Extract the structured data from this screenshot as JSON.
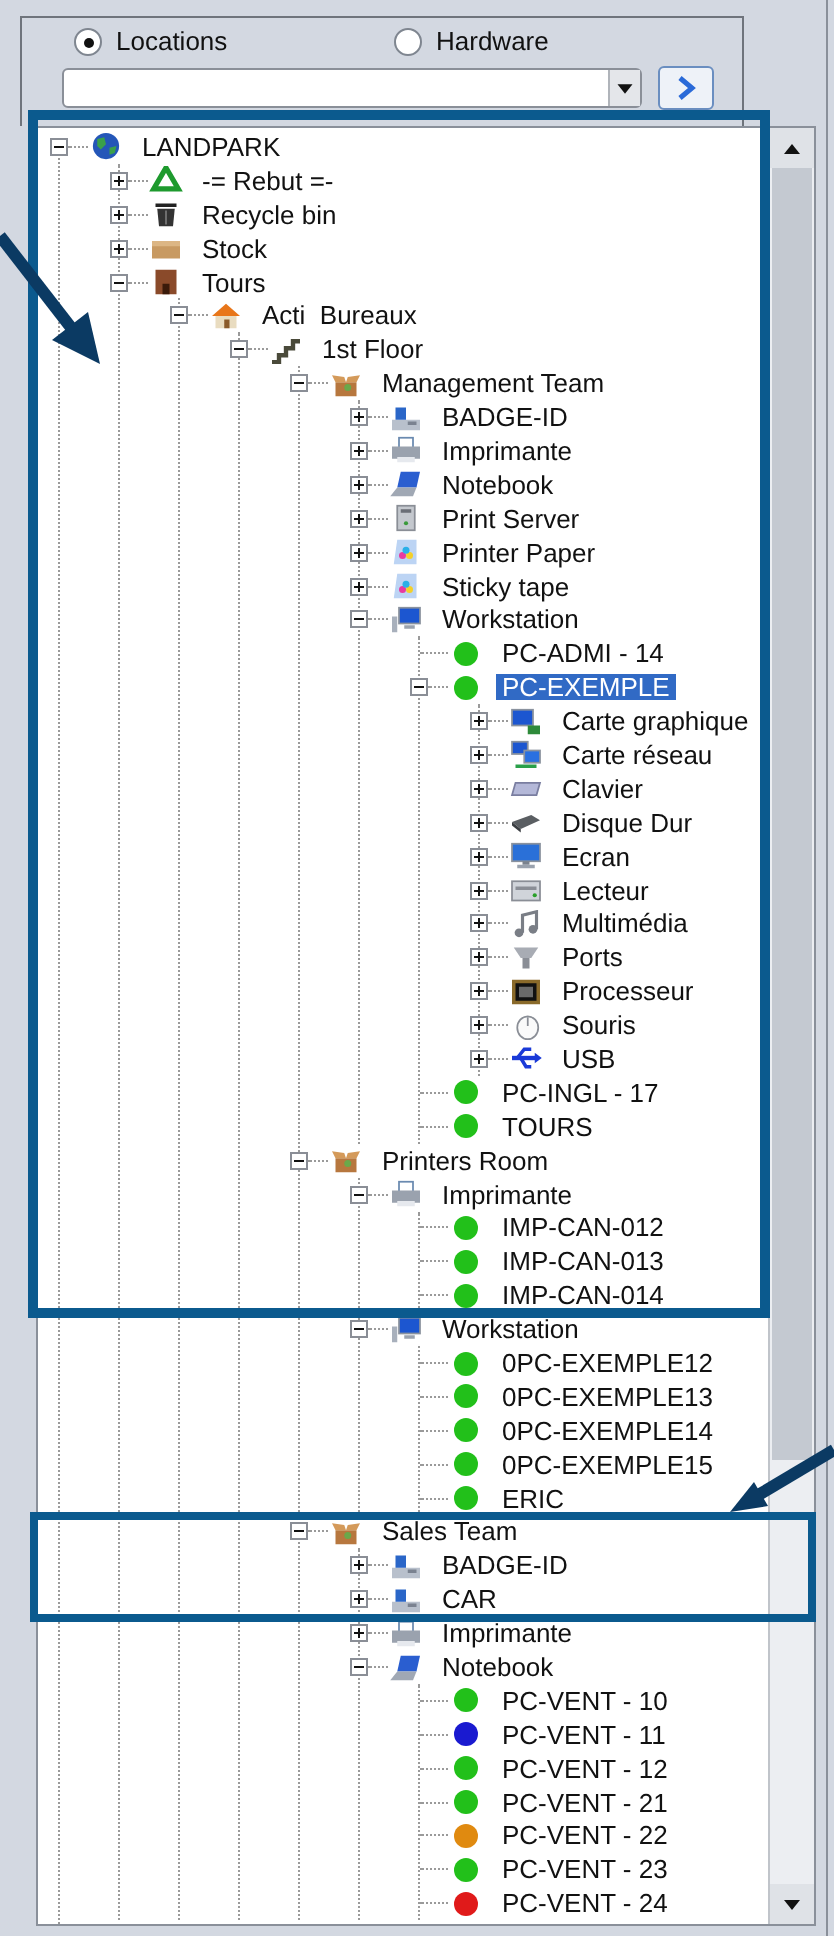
{
  "view_options": [
    {
      "label": "Locations",
      "selected": true
    },
    {
      "label": "Hardware",
      "selected": false
    }
  ],
  "tree": [
    {
      "label": "LANDPARK",
      "kind": "globe",
      "expanded": true,
      "selected": false,
      "children": [
        {
          "label": "-= Rebut =-",
          "kind": "recycle",
          "expanded": false,
          "selected": false
        },
        {
          "label": "Recycle bin",
          "kind": "trash",
          "expanded": false,
          "selected": false
        },
        {
          "label": "Stock",
          "kind": "box",
          "expanded": false,
          "selected": false
        },
        {
          "label": "Tours",
          "kind": "building",
          "expanded": true,
          "selected": false,
          "children": [
            {
              "label": "Acti  Bureaux",
              "kind": "house",
              "expanded": true,
              "selected": false,
              "children": [
                {
                  "label": "1st Floor",
                  "kind": "stairs",
                  "expanded": true,
                  "selected": false,
                  "children": [
                    {
                      "label": "Management Team",
                      "kind": "team",
                      "expanded": true,
                      "selected": false,
                      "children": [
                        {
                          "label": "BADGE-ID",
                          "kind": "badge",
                          "expanded": false,
                          "selected": false
                        },
                        {
                          "label": "Imprimante",
                          "kind": "printer",
                          "expanded": false,
                          "selected": false
                        },
                        {
                          "label": "Notebook",
                          "kind": "laptop",
                          "expanded": false,
                          "selected": false
                        },
                        {
                          "label": "Print Server",
                          "kind": "server",
                          "expanded": false,
                          "selected": false
                        },
                        {
                          "label": "Printer Paper",
                          "kind": "paper",
                          "expanded": false,
                          "selected": false
                        },
                        {
                          "label": "Sticky tape",
                          "kind": "paper",
                          "expanded": false,
                          "selected": false
                        },
                        {
                          "label": "Workstation",
                          "kind": "workstation",
                          "expanded": true,
                          "selected": false,
                          "children": [
                            {
                              "label": "PC-ADMI - 14",
                              "kind": "device",
                              "color": "#22c01a",
                              "selected": false
                            },
                            {
                              "label": "PC-EXEMPLE",
                              "kind": "device",
                              "color": "#22c01a",
                              "expanded": true,
                              "selected": true,
                              "children": [
                                {
                                  "label": "Carte graphique",
                                  "kind": "graphics",
                                  "expanded": false,
                                  "selected": false
                                },
                                {
                                  "label": "Carte réseau",
                                  "kind": "network",
                                  "expanded": false,
                                  "selected": false
                                },
                                {
                                  "label": "Clavier",
                                  "kind": "keyboard",
                                  "expanded": false,
                                  "selected": false
                                },
                                {
                                  "label": "Disque Dur",
                                  "kind": "disk",
                                  "expanded": false,
                                  "selected": false
                                },
                                {
                                  "label": "Ecran",
                                  "kind": "screen",
                                  "expanded": false,
                                  "selected": false
                                },
                                {
                                  "label": "Lecteur",
                                  "kind": "drive",
                                  "expanded": false,
                                  "selected": false
                                },
                                {
                                  "label": "Multimédia",
                                  "kind": "music",
                                  "expanded": false,
                                  "selected": false
                                },
                                {
                                  "label": "Ports",
                                  "kind": "ports",
                                  "expanded": false,
                                  "selected": false
                                },
                                {
                                  "label": "Processeur",
                                  "kind": "chip",
                                  "expanded": false,
                                  "selected": false
                                },
                                {
                                  "label": "Souris",
                                  "kind": "mouse",
                                  "expanded": false,
                                  "selected": false
                                },
                                {
                                  "label": "USB",
                                  "kind": "usb",
                                  "expanded": false,
                                  "selected": false
                                }
                              ]
                            },
                            {
                              "label": "PC-INGL - 17",
                              "kind": "device",
                              "color": "#22c01a",
                              "selected": false
                            },
                            {
                              "label": "TOURS",
                              "kind": "device",
                              "color": "#22c01a",
                              "selected": false
                            }
                          ]
                        }
                      ]
                    },
                    {
                      "label": "Printers Room",
                      "kind": "team",
                      "expanded": true,
                      "selected": false,
                      "children": [
                        {
                          "label": "Imprimante",
                          "kind": "printer",
                          "expanded": true,
                          "selected": false,
                          "children": [
                            {
                              "label": "IMP-CAN-012",
                              "kind": "device",
                              "color": "#22c01a",
                              "selected": false
                            },
                            {
                              "label": "IMP-CAN-013",
                              "kind": "device",
                              "color": "#22c01a",
                              "selected": false
                            },
                            {
                              "label": "IMP-CAN-014",
                              "kind": "device",
                              "color": "#22c01a",
                              "selected": false
                            }
                          ]
                        },
                        {
                          "label": "Workstation",
                          "kind": "workstation",
                          "expanded": true,
                          "selected": false,
                          "children": [
                            {
                              "label": "0PC-EXEMPLE12",
                              "kind": "device",
                              "color": "#22c01a",
                              "selected": false
                            },
                            {
                              "label": "0PC-EXEMPLE13",
                              "kind": "device",
                              "color": "#22c01a",
                              "selected": false
                            },
                            {
                              "label": "0PC-EXEMPLE14",
                              "kind": "device",
                              "color": "#22c01a",
                              "selected": false
                            },
                            {
                              "label": "0PC-EXEMPLE15",
                              "kind": "device",
                              "color": "#22c01a",
                              "selected": false
                            },
                            {
                              "label": "ERIC",
                              "kind": "device",
                              "color": "#22c01a",
                              "selected": false
                            }
                          ]
                        }
                      ]
                    },
                    {
                      "label": "Sales Team",
                      "kind": "team",
                      "expanded": true,
                      "selected": false,
                      "children": [
                        {
                          "label": "BADGE-ID",
                          "kind": "badge",
                          "expanded": false,
                          "selected": false
                        },
                        {
                          "label": "CAR",
                          "kind": "badge",
                          "expanded": false,
                          "selected": false
                        },
                        {
                          "label": "Imprimante",
                          "kind": "printer",
                          "expanded": false,
                          "selected": false
                        },
                        {
                          "label": "Notebook",
                          "kind": "laptop",
                          "expanded": true,
                          "selected": false,
                          "children": [
                            {
                              "label": "PC-VENT - 10",
                              "kind": "device",
                              "color": "#22c01a",
                              "selected": false
                            },
                            {
                              "label": "PC-VENT - 11",
                              "kind": "device",
                              "color": "#1a1ad0",
                              "selected": false
                            },
                            {
                              "label": "PC-VENT - 12",
                              "kind": "device",
                              "color": "#22c01a",
                              "selected": false
                            },
                            {
                              "label": "PC-VENT - 21",
                              "kind": "device",
                              "color": "#22c01a",
                              "selected": false
                            },
                            {
                              "label": "PC-VENT - 22",
                              "kind": "device",
                              "color": "#e08a10",
                              "selected": false
                            },
                            {
                              "label": "PC-VENT - 23",
                              "kind": "device",
                              "color": "#22c01a",
                              "selected": false
                            },
                            {
                              "label": "PC-VENT - 24",
                              "kind": "device",
                              "color": "#e01a1a",
                              "selected": false
                            }
                          ]
                        }
                      ]
                    }
                  ]
                }
              ]
            }
          ]
        }
      ]
    }
  ]
}
